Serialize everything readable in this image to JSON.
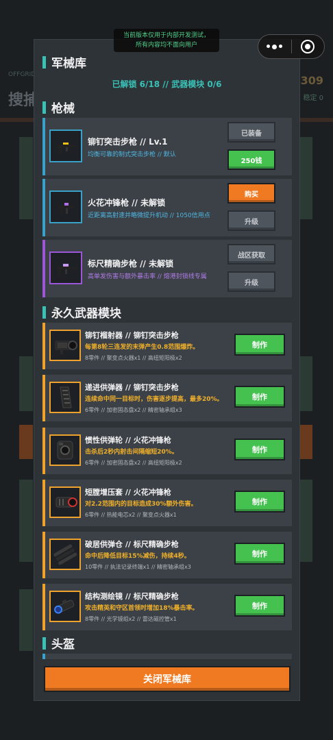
{
  "system": {
    "dev_notice_line1": "当前版本仅用于内部开发测试，",
    "dev_notice_line2": "所有内容均不面向用户"
  },
  "background": {
    "title": "搜捕",
    "small_label": "OFFGRID",
    "right_number": "309",
    "right_sub": "稳定 0"
  },
  "armory": {
    "title": "军械库",
    "unlock_status": "已解锁 6/18 // 武器模块 0/6",
    "guns_section": "枪械",
    "weapons": [
      {
        "name": "铆钉突击步枪 // Lv.1",
        "desc": "均衡可靠的制式突击步枪 // 默认",
        "btn_top": "已装备",
        "btn_bottom": "250钱"
      },
      {
        "name": "火花冲锋枪 // 未解锁",
        "desc": "近距离高射速并略微提升机动 // 1050信用点",
        "btn_top": "购买",
        "btn_bottom": "升级"
      },
      {
        "name": "标尺精确步枪 // 未解锁",
        "desc": "高单发伤害与额外暴击率 // 熔港封锁线专属",
        "btn_top": "战区获取",
        "btn_bottom": "升级"
      }
    ],
    "modules_section": "永久武器模块",
    "modules": [
      {
        "title": "铆钉榴射器 // 铆钉突击步枪",
        "effect": "每第8轮三连发的末弹产生0.8范围爆炸。",
        "cost": "8零件 // 聚变点火器x1 // 高纽矩阳极x2",
        "btn": "制作"
      },
      {
        "title": "递进供弹器 // 铆钉突击步枪",
        "effect": "连续命中同一目标时，伤害逐步提高，最多20%。",
        "cost": "6零件 // 加密固态盘x2 // 精密轴承组x3",
        "btn": "制作"
      },
      {
        "title": "惯性供弹轮 // 火花冲锋枪",
        "effect": "击杀后2秒内射击间隔缩短20%。",
        "cost": "6零件 // 加密固态盘x2 // 高纽矩阳极x2",
        "btn": "制作"
      },
      {
        "title": "短膛增压套 // 火花冲锋枪",
        "effect": "对2.2范围内的目标造成30%额外伤害。",
        "cost": "6零件 // 热能电芯x2 // 聚变点火器x1",
        "btn": "制作"
      },
      {
        "title": "破居供弹仓 // 标尺精确步枪",
        "effect": "命中后降低目标15%减伤，持续4秒。",
        "cost": "10零件 // 执法记录终端x1 // 精密轴承组x3",
        "btn": "制作"
      },
      {
        "title": "结构测绘镜 // 标尺精确步枪",
        "effect": "攻击精英和守区首领时增加18%暴击率。",
        "cost": "8零件 // 光学镜组x2 // 雷达磁控管x1",
        "btn": "制作"
      }
    ],
    "helmet_section": "头盔",
    "close_label": "关闭军械库"
  },
  "colors": {
    "teal": "#39c1b6",
    "blue": "#3aa1c9",
    "purple": "#9b57d8",
    "gold": "#f0a32c",
    "green": "#45c150",
    "orange": "#f07a22"
  }
}
